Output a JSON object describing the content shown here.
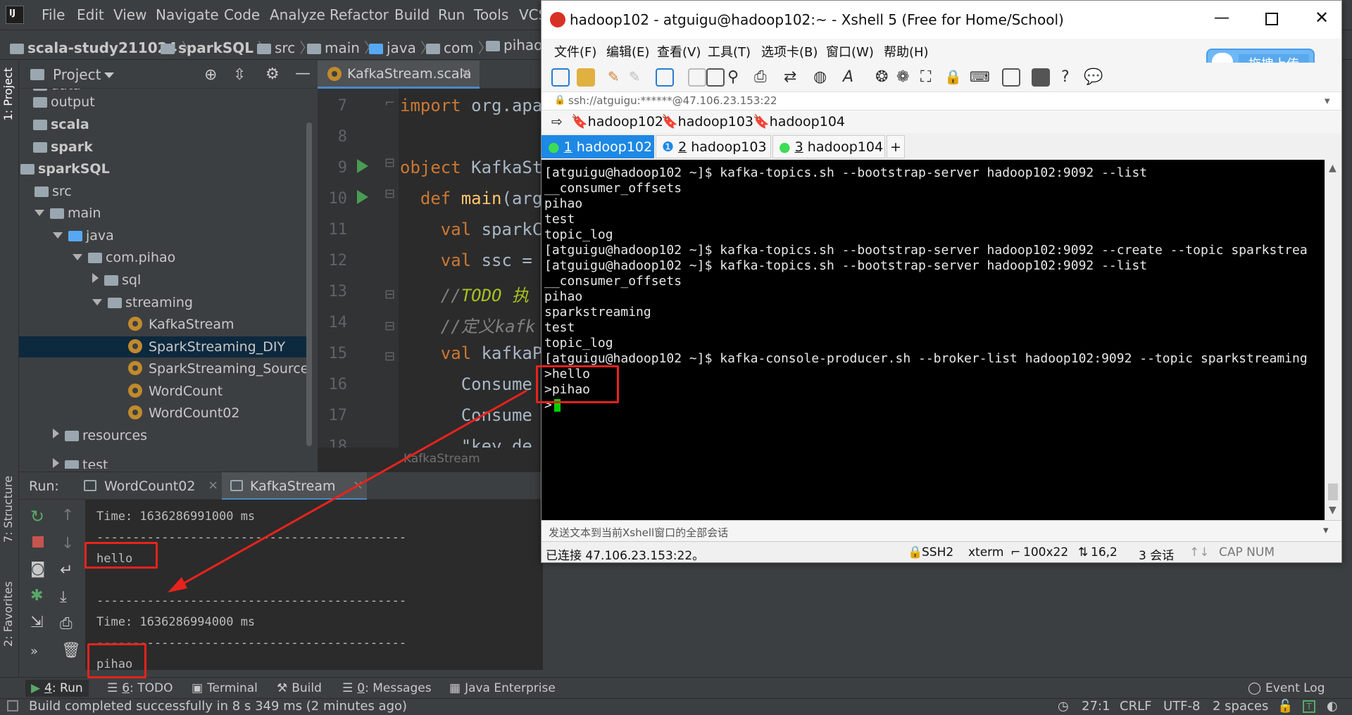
{
  "ide": {
    "menu": [
      "File",
      "Edit",
      "View",
      "Navigate",
      "Code",
      "Analyze",
      "Refactor",
      "Build",
      "Run",
      "Tools",
      "VCS"
    ],
    "breadcrumbs": [
      "scala-study211024",
      "sparkSQL",
      "src",
      "main",
      "java",
      "com",
      "pihao"
    ],
    "project_label": "Project",
    "tree": [
      {
        "label": "data"
      },
      {
        "label": "output"
      },
      {
        "label": "scala"
      },
      {
        "label": "spark"
      },
      {
        "label": "sparkSQL"
      },
      {
        "label": "src"
      },
      {
        "label": "main"
      },
      {
        "label": "java"
      },
      {
        "label": "com.pihao"
      },
      {
        "label": "sql"
      },
      {
        "label": "streaming"
      },
      {
        "label": "KafkaStream"
      },
      {
        "label": "SparkStreaming_DIY"
      },
      {
        "label": "SparkStreaming_Source"
      },
      {
        "label": "WordCount"
      },
      {
        "label": "WordCount02"
      },
      {
        "label": "resources"
      },
      {
        "label": "test"
      }
    ],
    "editor_tab": "KafkaStream.scala",
    "editor_tab_close": "×",
    "code_lines": [
      {
        "num": "7",
        "parts": [
          {
            "t": "import",
            "c": "kw"
          },
          {
            "t": " org.apa",
            "c": ""
          }
        ]
      },
      {
        "num": "8",
        "parts": []
      },
      {
        "num": "9",
        "parts": [
          {
            "t": "object",
            "c": "kw"
          },
          {
            "t": " KafkaSt",
            "c": ""
          }
        ]
      },
      {
        "num": "10",
        "parts": [
          {
            "t": "  def",
            "c": "kw"
          },
          {
            "t": " main",
            "c": "tp"
          },
          {
            "t": "(arg",
            "c": ""
          }
        ]
      },
      {
        "num": "11",
        "parts": [
          {
            "t": "    val",
            "c": "kw"
          },
          {
            "t": " sparkC",
            "c": ""
          }
        ]
      },
      {
        "num": "12",
        "parts": [
          {
            "t": "    val",
            "c": "kw"
          },
          {
            "t": " ssc =",
            "c": ""
          }
        ]
      },
      {
        "num": "13",
        "parts": [
          {
            "t": "    //",
            "c": "cm"
          },
          {
            "t": "TODO 执",
            "c": "todo"
          }
        ]
      },
      {
        "num": "14",
        "parts": [
          {
            "t": "    //定义kafk",
            "c": "cm"
          }
        ]
      },
      {
        "num": "15",
        "parts": [
          {
            "t": "    val",
            "c": "kw"
          },
          {
            "t": " kafkaP",
            "c": ""
          }
        ]
      },
      {
        "num": "16",
        "parts": [
          {
            "t": "      Consume",
            "c": ""
          }
        ]
      },
      {
        "num": "17",
        "parts": [
          {
            "t": "      Consume",
            "c": ""
          }
        ]
      },
      {
        "num": "18",
        "parts": [
          {
            "t": "      \"key.de",
            "c": ""
          }
        ]
      }
    ],
    "editor_breadcrumb": "KafkaStream",
    "run_label": "Run:",
    "run_tabs": [
      "WordCount02",
      "KafkaStream"
    ],
    "console_lines": [
      "Time: 1636286991000 ms",
      "-------------------------------------------",
      "hello",
      "",
      "-------------------------------------------",
      "Time: 1636286994000 ms",
      "-------------------------------------------",
      "pihao"
    ],
    "bottom_tabs": [
      {
        "num": "4",
        "label": ": Run"
      },
      {
        "num": "6",
        "label": ": TODO"
      },
      {
        "num": "",
        "label": "Terminal"
      },
      {
        "num": "",
        "label": "Build"
      },
      {
        "num": "0",
        "label": ": Messages"
      },
      {
        "num": "",
        "label": "Java Enterprise"
      }
    ],
    "event_log": "Event Log",
    "status_message": "Build completed successfully in 8 s 349 ms (2 minutes ago)",
    "status_right": [
      "27:1",
      "CRLF",
      "UTF-8",
      "2 spaces"
    ],
    "left_tabs": [
      "1: Project",
      "7: Structure",
      "2: Favorites"
    ]
  },
  "xshell": {
    "title": "hadoop102 - atguigu@hadoop102:~ - Xshell 5 (Free for Home/School)",
    "menu": [
      "文件(F)",
      "编辑(E)",
      "查看(V)",
      "工具(T)",
      "选项卡(B)",
      "窗口(W)",
      "帮助(H)"
    ],
    "upload_btn": "拖拽上传",
    "address": "ssh://atguigu:******@47.106.23.153:22",
    "links": [
      "hadoop102",
      "hadoop103",
      "hadoop104"
    ],
    "tabs": [
      {
        "num": "1",
        "label": " hadoop102"
      },
      {
        "num": "2",
        "label": " hadoop103"
      },
      {
        "num": "3",
        "label": " hadoop104"
      }
    ],
    "terminal_lines": [
      "[atguigu@hadoop102 ~]$ kafka-topics.sh --bootstrap-server hadoop102:9092 --list",
      "__consumer_offsets",
      "pihao",
      "test",
      "topic_log",
      "[atguigu@hadoop102 ~]$ kafka-topics.sh --bootstrap-server hadoop102:9092 --create --topic sparkstrea",
      "[atguigu@hadoop102 ~]$ kafka-topics.sh --bootstrap-server hadoop102:9092 --list",
      "__consumer_offsets",
      "pihao",
      "sparkstreaming",
      "test",
      "topic_log",
      "[atguigu@hadoop102 ~]$ kafka-console-producer.sh --broker-list hadoop102:9092 --topic sparkstreaming",
      ">hello",
      ">pihao",
      ">"
    ],
    "send_bar": "发送文本到当前Xshell窗口的全部会话",
    "status": [
      "已连接 47.106.23.153:22。",
      "SSH2",
      "xterm",
      "100x22",
      "16,2",
      "3 会话",
      "CAP NUM"
    ]
  },
  "colors": {
    "annotation": "#e8231d",
    "cursor": "#00d000",
    "xshell_tab_active": "#1e88e5"
  }
}
